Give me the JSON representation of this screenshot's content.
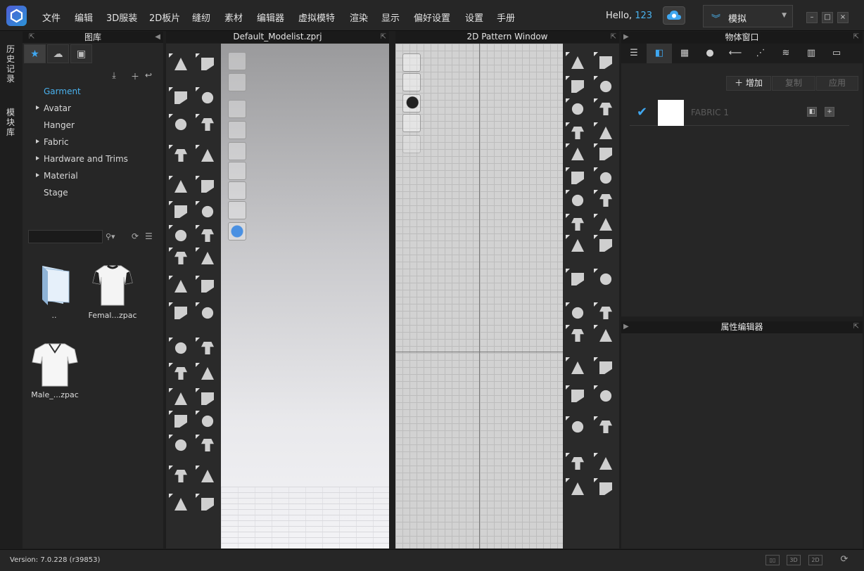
{
  "menu": {
    "items": [
      "文件",
      "编辑",
      "3D服装",
      "2D板片",
      "缝纫",
      "素材",
      "编辑器",
      "虚拟模特",
      "渲染",
      "显示",
      "偏好设置",
      "设置",
      "手册"
    ],
    "hello_prefix": "Hello,",
    "user": "123",
    "mode_label": "模拟"
  },
  "side_tabs": {
    "history": "历史记录",
    "modular": "模块库"
  },
  "library": {
    "title": "图库",
    "tree": [
      {
        "label": "Garment",
        "expandable": false,
        "selected": true
      },
      {
        "label": "Avatar",
        "expandable": true
      },
      {
        "label": "Hanger",
        "expandable": false
      },
      {
        "label": "Fabric",
        "expandable": true
      },
      {
        "label": "Hardware and Trims",
        "expandable": true
      },
      {
        "label": "Material",
        "expandable": true
      },
      {
        "label": "Stage",
        "expandable": false
      }
    ],
    "search_value": "",
    "files": [
      {
        "label": "..",
        "type": "folder"
      },
      {
        "label": "Femal...zpac",
        "type": "female-shirt"
      },
      {
        "label": "Male_...zpac",
        "type": "male-shirt"
      }
    ]
  },
  "view3d": {
    "title": "Default_Modelist.zprj"
  },
  "view2d": {
    "title": "2D Pattern Window"
  },
  "object_window": {
    "title": "物体窗口",
    "actions": {
      "add": "增加",
      "copy": "复制",
      "apply": "应用"
    },
    "fabrics": [
      {
        "name": "FABRIC 1",
        "checked": true,
        "color": "#ffffff"
      }
    ]
  },
  "property_editor": {
    "title": "属性编辑器"
  },
  "status": {
    "version": "Version: 7.0.228 (r39853)",
    "btn_3d": "3D",
    "btn_2d": "2D"
  },
  "colors": {
    "accent": "#4ab2ee",
    "panel": "#262626",
    "header": "#191919"
  }
}
